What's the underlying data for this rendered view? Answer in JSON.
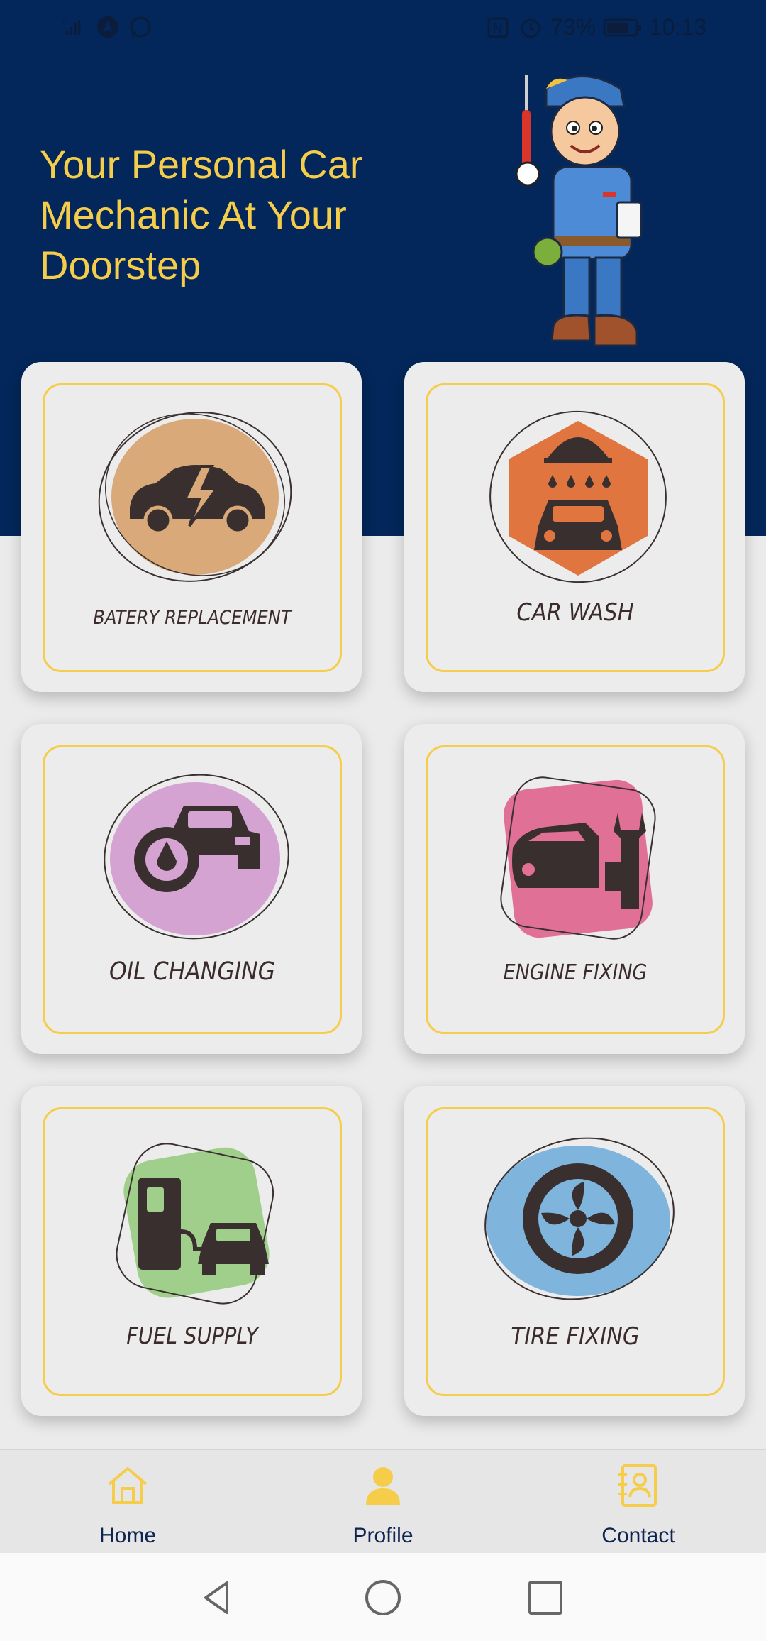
{
  "status_bar": {
    "battery": "73%",
    "time": "10:13",
    "left_icons": [
      "signal-icon",
      "navigation-icon",
      "whatsapp-icon"
    ],
    "right_icons": [
      "nfc-icon",
      "alarm-icon",
      "battery-icon"
    ]
  },
  "hero": {
    "title": "Your Personal Car Mechanic At Your Doorstep",
    "mascot": "mechanic-mascot"
  },
  "services": [
    {
      "label": "BATERY REPLACEMENT",
      "icon": "car-battery-icon",
      "color": "#d9a97a"
    },
    {
      "label": "CAR WASH",
      "icon": "car-wash-icon",
      "color": "#e0753f"
    },
    {
      "label": "OIL CHANGING",
      "icon": "oil-change-icon",
      "color": "#d4a3d2"
    },
    {
      "label": "ENGINE FIXING",
      "icon": "engine-fix-icon",
      "color": "#e07095"
    },
    {
      "label": "FUEL SUPPLY",
      "icon": "fuel-pump-icon",
      "color": "#9fcf8a"
    },
    {
      "label": "TIRE FIXING",
      "icon": "tire-icon",
      "color": "#7fb5dd"
    }
  ],
  "bottom_nav": [
    {
      "label": "Home",
      "icon": "home-icon"
    },
    {
      "label": "Profile",
      "icon": "profile-icon"
    },
    {
      "label": "Contact",
      "icon": "contact-icon"
    }
  ],
  "colors": {
    "hero_bg": "#03275a",
    "accent": "#f5cd4b",
    "label_text": "#3c2b2b",
    "nav_text": "#0d2550"
  }
}
